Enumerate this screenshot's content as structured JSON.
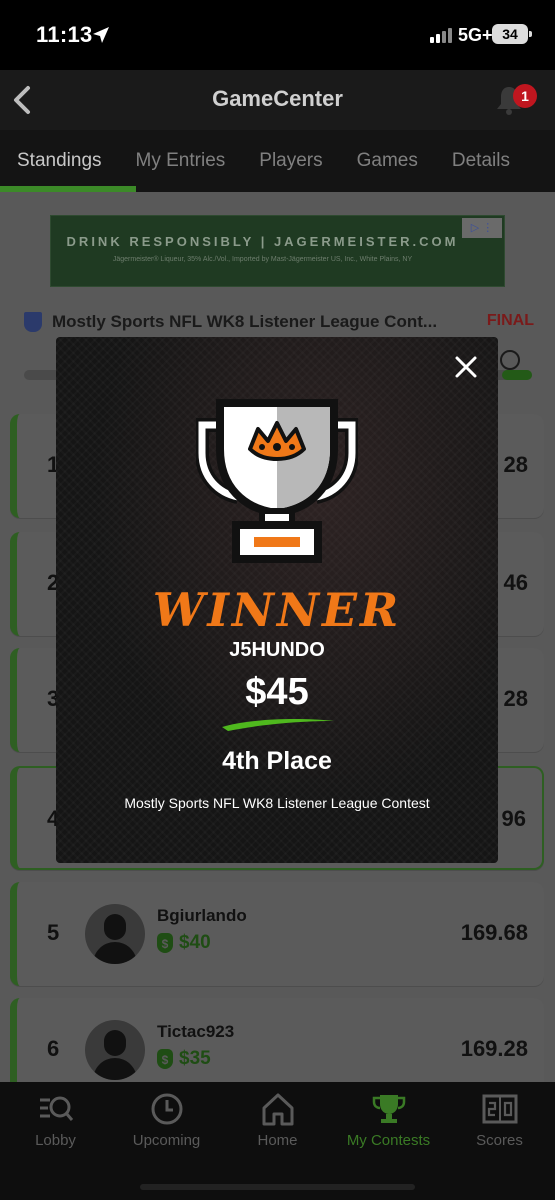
{
  "status_bar": {
    "time": "11:13",
    "network": "5G+",
    "battery": "34"
  },
  "header": {
    "title": "GameCenter",
    "notification_count": "1"
  },
  "tabs": [
    {
      "label": "Standings",
      "active": true
    },
    {
      "label": "My Entries",
      "active": false
    },
    {
      "label": "Players",
      "active": false
    },
    {
      "label": "Games",
      "active": false
    },
    {
      "label": "Details",
      "active": false
    }
  ],
  "ad": {
    "headline": "DRINK RESPONSIBLY | JAGERMEISTER.COM",
    "fine_print": "Jägermeister® Liqueur, 35% Alc./Vol., Imported by Mast-Jägermeister US, Inc., White Plains, NY"
  },
  "contest": {
    "name": "Mostly Sports NFL WK8 Listener League Cont...",
    "status": "FINAL"
  },
  "standings": [
    {
      "rank": "1",
      "score": "28"
    },
    {
      "rank": "2",
      "score": "46"
    },
    {
      "rank": "3",
      "score": "28"
    },
    {
      "rank": "4",
      "score": "96"
    },
    {
      "rank": "5",
      "username": "Bgiurlando",
      "prize": "$40",
      "score": "169.68"
    },
    {
      "rank": "6",
      "username": "Tictac923",
      "prize": "$35",
      "score": "169.28"
    }
  ],
  "modal": {
    "title": "WINNER",
    "username": "J5HUNDO",
    "amount": "$45",
    "place": "4th Place",
    "contest": "Mostly Sports NFL WK8 Listener League Contest"
  },
  "bottom_nav": [
    {
      "label": "Lobby",
      "icon": "lobby-icon"
    },
    {
      "label": "Upcoming",
      "icon": "clock-icon"
    },
    {
      "label": "Home",
      "icon": "home-icon"
    },
    {
      "label": "My Contests",
      "icon": "trophy-icon",
      "active": true
    },
    {
      "label": "Scores",
      "icon": "scoreboard-icon"
    }
  ],
  "colors": {
    "accent_green": "#3c8a28",
    "winner_orange": "#f07818",
    "final_red": "#c0161f"
  }
}
